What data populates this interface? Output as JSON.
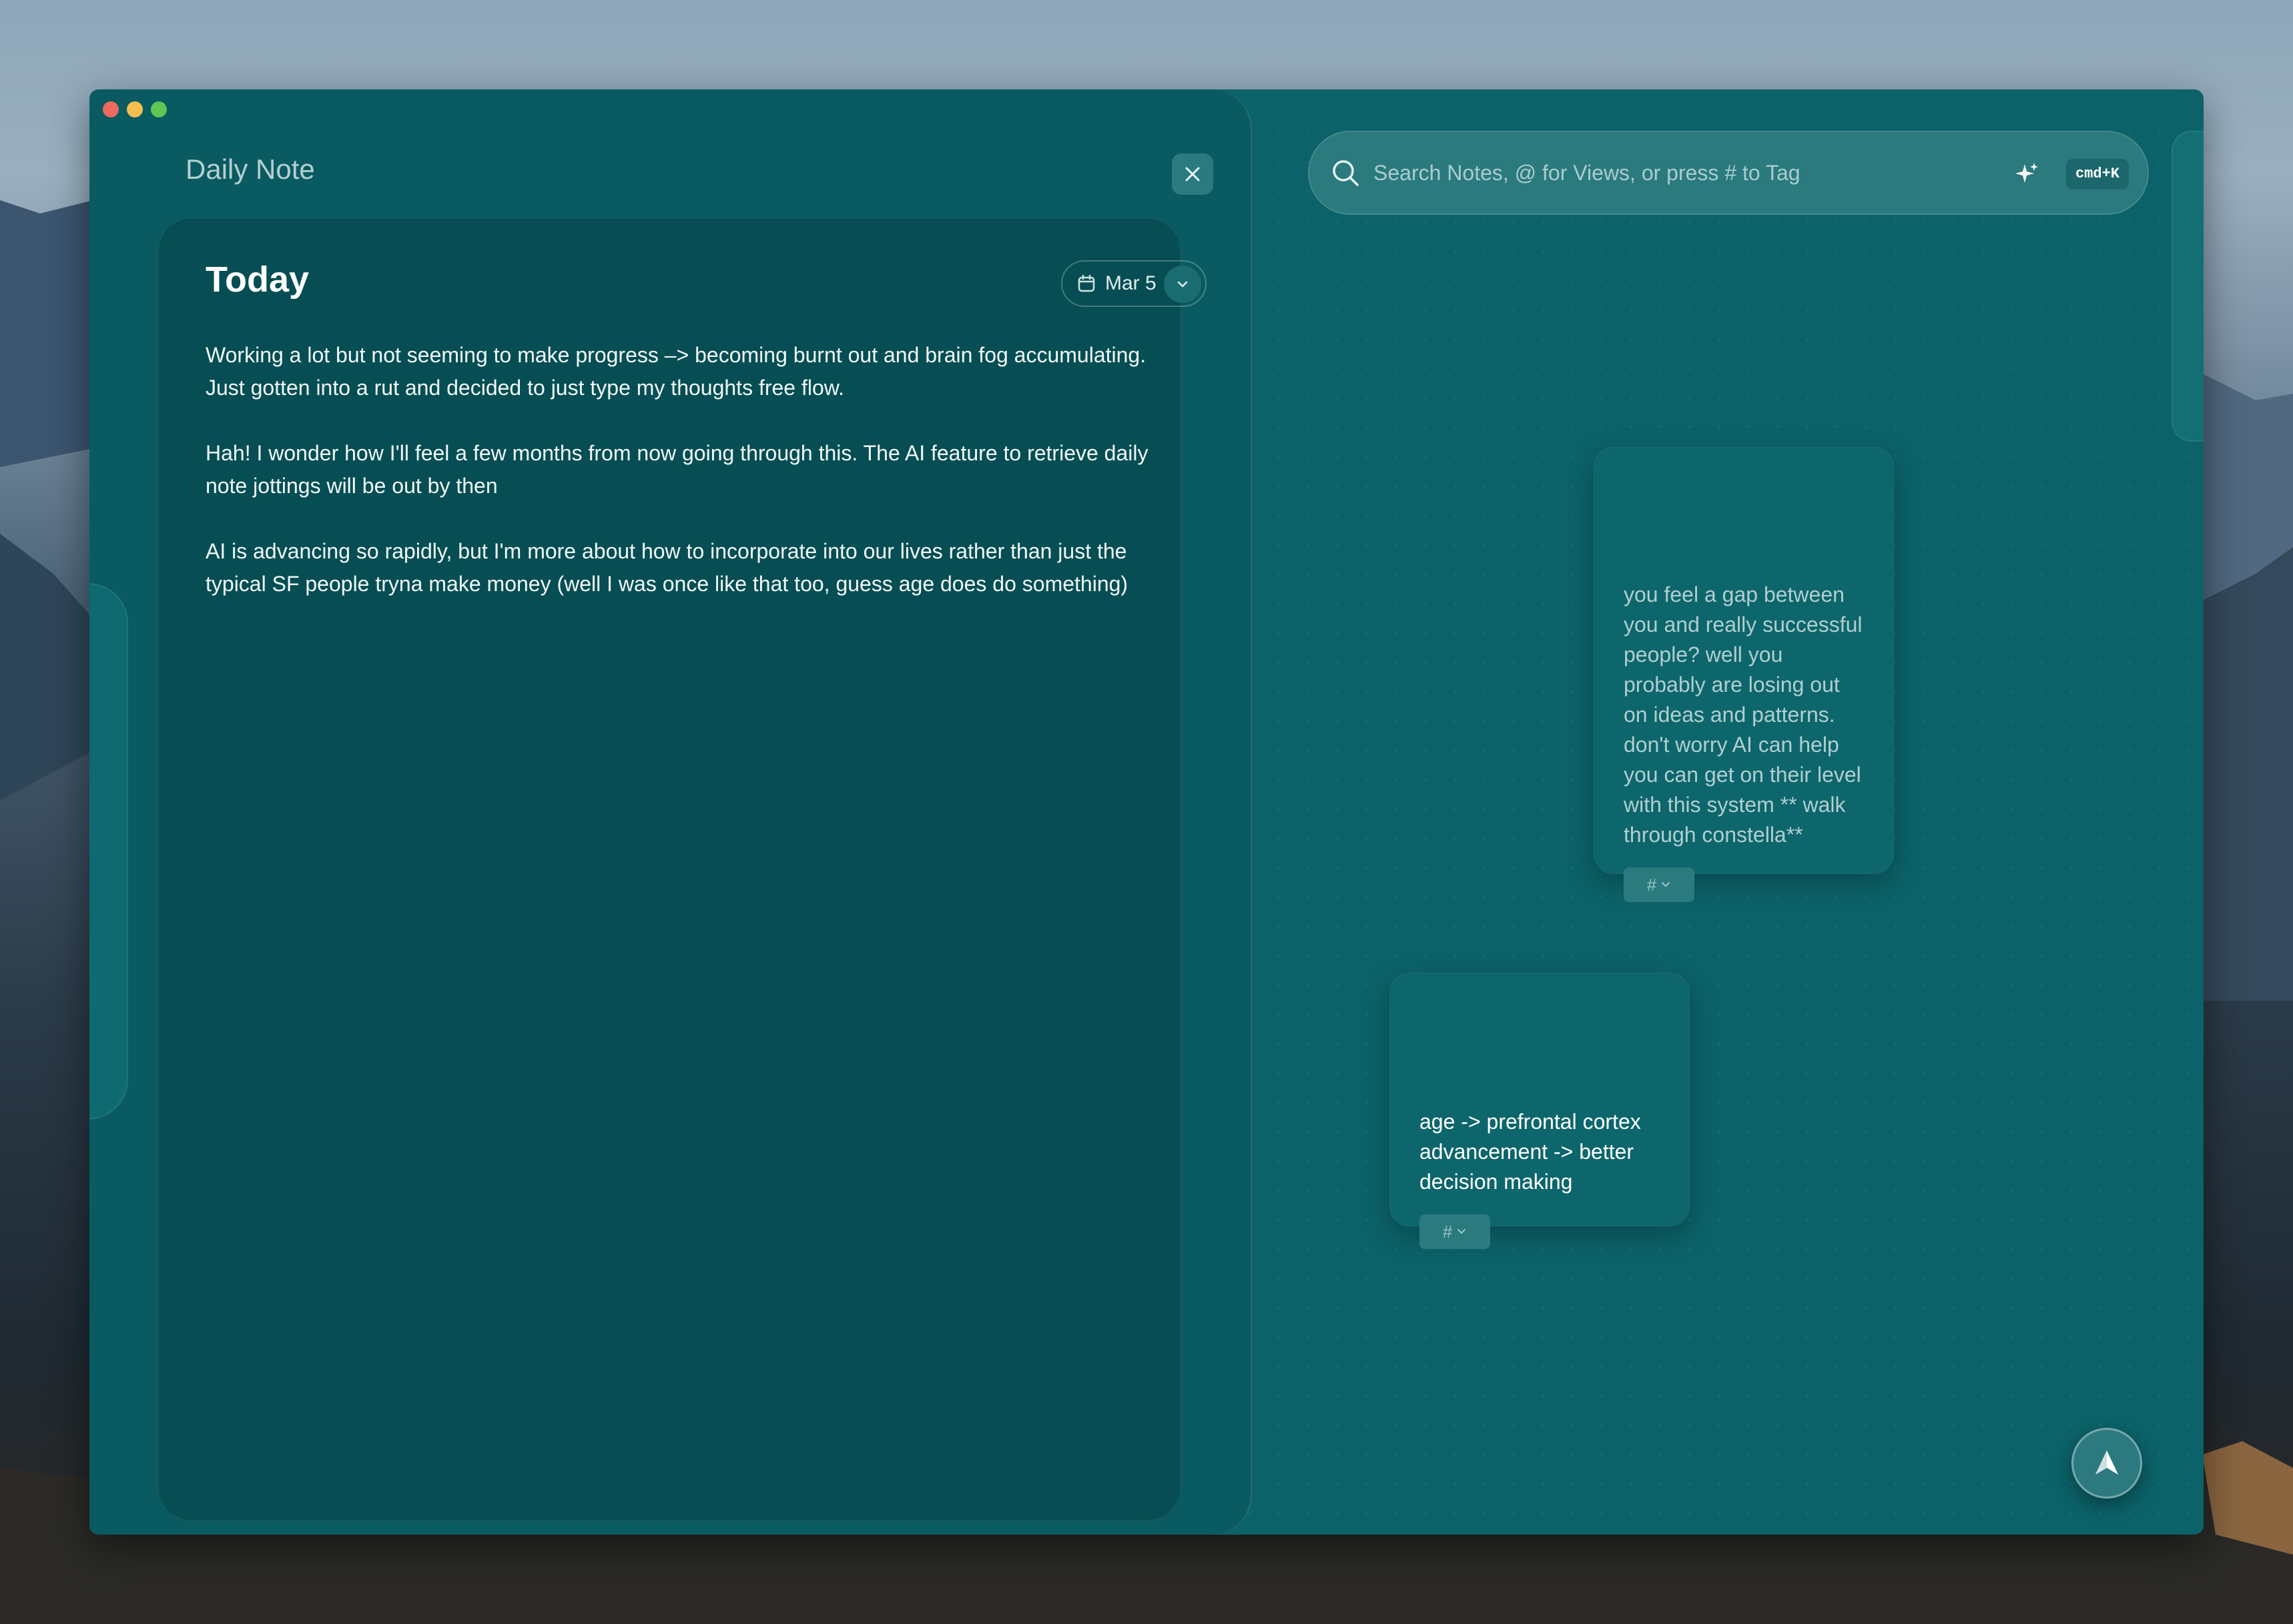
{
  "panel": {
    "title": "Daily Note"
  },
  "note": {
    "heading": "Today",
    "date": "Mar 5",
    "paragraphs": [
      "Working a lot but not seeming to make progress –> becoming burnt out and brain fog accumulating. Just gotten into a rut and decided to just type my thoughts free flow.",
      "Hah! I wonder how I'll feel a few months from now going through this. The AI feature to retrieve daily note jottings will be out by then",
      "AI is advancing so rapidly, but I'm more about how to incorporate into our lives rather than just the typical SF people tryna make money (well I was once like that too, guess age does do something)"
    ]
  },
  "search": {
    "placeholder": "Search Notes, @ for Views, or press # to Tag",
    "shortcut": "cmd+K"
  },
  "cards": [
    {
      "text": "you feel a gap between you and really successful people? well you probably are losing out on ideas and patterns. don't worry AI can help you can get on their level with this system ** walk through constella**",
      "tag": "#"
    },
    {
      "text": "age -> prefrontal cortex advancement -> better decision making",
      "tag": "#"
    }
  ],
  "colors": {
    "window": "#0b6268",
    "panel": "#095b61",
    "note_card": "#064e53",
    "accent": "#2a7a7e"
  },
  "icons": [
    "search-icon",
    "sparkle-icon",
    "calendar-icon",
    "chevron-down-icon",
    "close-icon",
    "hashtag-icon",
    "navigate-arrow-icon"
  ]
}
